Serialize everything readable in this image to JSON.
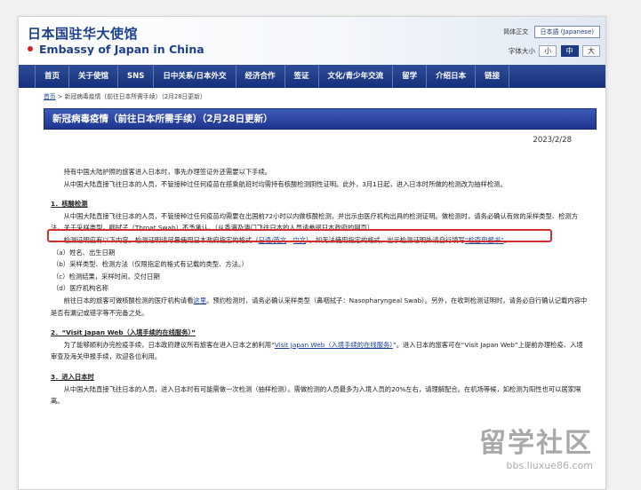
{
  "header": {
    "site_title": "日本国驻华大使馆",
    "site_subtitle": "Embassy of Japan in China",
    "lang_label": "简体正文",
    "lang_button": "日本語 (Japanese)",
    "font_size_label": "字体大小",
    "font_sizes": [
      "小",
      "中",
      "大"
    ]
  },
  "nav": {
    "items": [
      "首页",
      "关于使馆",
      "SNS",
      "日中关系/日本外交",
      "经济合作",
      "签证",
      "文化/青少年交流",
      "留学",
      "介绍日本",
      "链接"
    ]
  },
  "breadcrumb": {
    "home": "首页",
    "current": " > 新冠病毒疫情（前往日本所需手续）（2月28日更新）"
  },
  "page": {
    "title": "新冠病毒疫情（前往日本所需手续）（2月28日更新）",
    "date": "2023/2/28"
  },
  "content": {
    "intro_1": "持有中国大陆护照的旅客进入日本时，事先办理签证外还需要以下手续。",
    "intro_2": "从中国大陆直接飞往日本的人员，不管接种过任何疫苗在搭乘航班时均需持有核酸检测阴性证明。此外，3月1日起，进入日本时所做的检测改为抽样检测。",
    "sec1_title": "1．核酸检测",
    "sec1_p1": "从中国大陆直接飞往日本的人员，不管接种过任何疫苗均需要在出国前72小时以内做核酸检测，并出示由医疗机构出具的检测证明。做检测时，请务必确认有效的采样类型、检测方法。关于采样类型，咽拭子（Throat Swab）不予承认。（从香港及澳门飞往日本的人员请参阅日本政府的网页）",
    "sec1_p2_a": "检测证明应有以下内容。检测证明请尽量使用日本政府指定的格式（",
    "sec1_link_jp": "日语/英文",
    "sec1_sep": "、",
    "sec1_link_cn": "中文",
    "sec1_p2_b": "）。如无法使用指定的格式，出示检测证明外请自行填写",
    "sec1_link_form": "“检查申报书”",
    "sec1_p2_end": "。",
    "sec1_items": [
      "（a）姓名、出生日期",
      "（b）采样类型、检测方法（仅限指定的格式有记载的类型、方法。）",
      "（c）检测结果，采样时间，交付日期",
      "（d）医疗机构名称"
    ],
    "sec1_p3_a": "前往日本的旅客可做核酸检测的医疗机构请看",
    "sec1_link_here": "这里",
    "sec1_p3_b": "。预约检测时，请务必确认采样类型（鼻咽拭子：Nasopharyngeal Swab）。另外，在收到检测证明时，请务必自行确认记载内容中是否有漏记或错字等不完备之处。",
    "sec2_title": "2．“Visit Japan Web（入境手续的在线服务）”",
    "sec2_p1_a": "为了能够顺利办完检疫手续，日本政府建议所有旅客在进入日本之前利用“",
    "sec2_link": "Visit Japan Web（入境手续的在线服务）",
    "sec2_p1_b": "”。进入日本的旅客可在“Visit Japan Web”上提前办理检疫、入境审查及海关申报手续，欢迎各位利用。",
    "sec3_title": "3．进入日本时",
    "sec3_p1": "从中国大陆直接飞往日本的人员，进入日本时有可能需做一次检测（抽样检测）。需做检测的人员最多为入境人员的20%左右，请理解配合。在机场等候，如检测为阳性也可以居家隔离。"
  },
  "watermark": {
    "logo": "留学社区",
    "url": "bbs.liuxue86.com"
  },
  "colors": {
    "nav_bg": "#1f3b8a",
    "title_text": "#1e3f8c",
    "highlight_border": "#d32f2f",
    "link": "#1a3f9c"
  }
}
